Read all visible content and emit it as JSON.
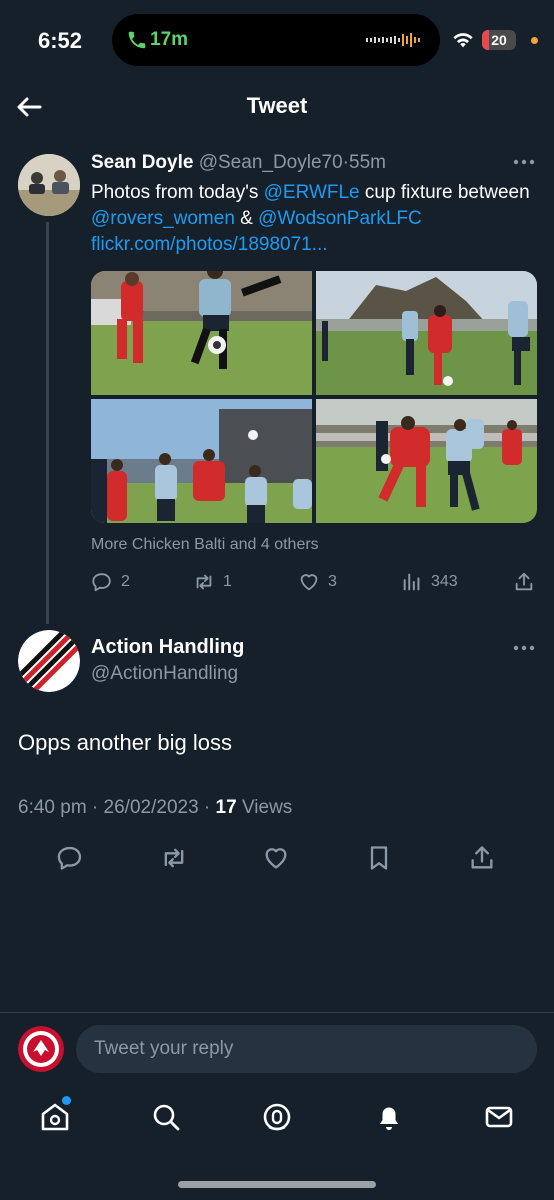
{
  "status_bar": {
    "time": "6:52",
    "call_duration": "17m",
    "battery_percent": "20",
    "battery_level": 0.2,
    "colors": {
      "call_green": "#5fd36b",
      "battery_red": "#e5484d",
      "privacy_dot": "#f2a33a"
    }
  },
  "header": {
    "title": "Tweet",
    "back_icon": "arrow-left-icon"
  },
  "tweet1": {
    "author_name": "Sean Doyle",
    "handle": "@Sean_Doyle70",
    "separator": "·",
    "age": "55m",
    "text_parts": {
      "p1": "Photos from today's ",
      "mention1": "@ERWFLe",
      "p2": " cup fixture between ",
      "mention2": "@rovers_women",
      "p3": " & ",
      "mention3": "@WodsonParkLFC",
      "link": "flickr.com/photos/1898071..."
    },
    "liked_by": "More Chicken Balti and 4 others",
    "replies": "2",
    "retweets": "1",
    "likes": "3",
    "views": "343"
  },
  "tweet2": {
    "author_name": "Action Handling",
    "handle": "@ActionHandling",
    "text": "Opps another big loss",
    "time": "6:40 pm",
    "sep1": " · ",
    "date": "26/02/2023",
    "sep2": " · ",
    "views_count": "17",
    "views_label": " Views"
  },
  "reply": {
    "placeholder": "Tweet your reply"
  },
  "nav": {
    "items": [
      "home-icon",
      "search-icon",
      "spaces-icon",
      "notifications-icon",
      "messages-icon"
    ]
  },
  "colors": {
    "background": "#15202b",
    "link": "#1d9bf0",
    "secondary_text": "#8b98a5"
  }
}
